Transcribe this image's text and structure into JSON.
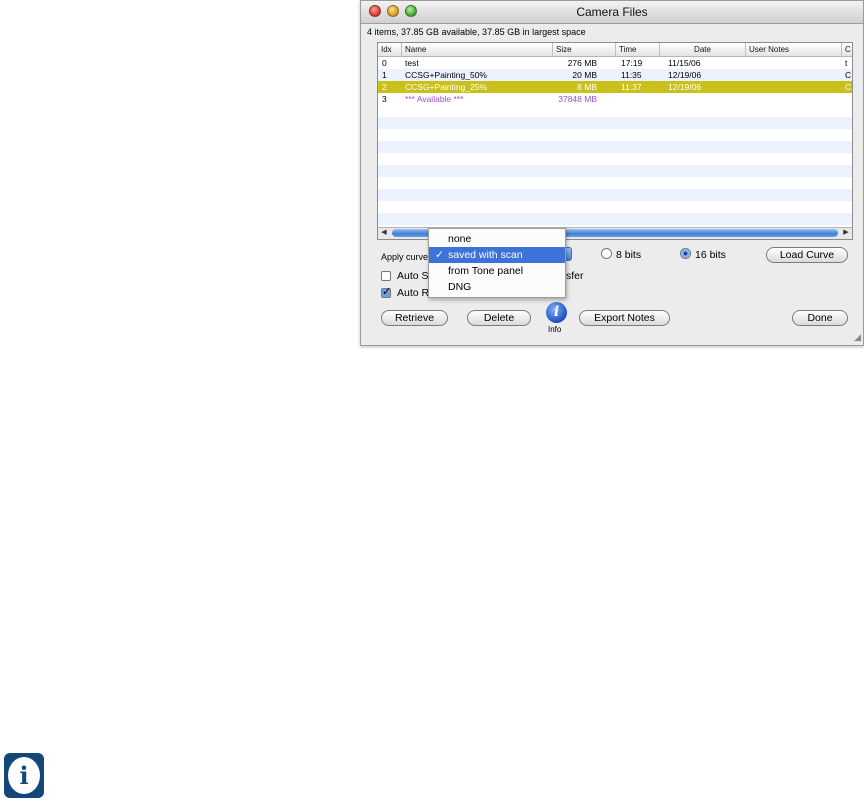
{
  "window": {
    "title": "Camera Files",
    "summary": "4 items,  37.85 GB available,  37.85 GB in largest space"
  },
  "table": {
    "columns": [
      "Idx",
      "Name",
      "Size",
      "Time",
      "Date",
      "User Notes",
      "C"
    ],
    "rows": [
      {
        "idx": "0",
        "name": "test",
        "size": "276 MB",
        "time": "17:19",
        "date": "11/15/06",
        "notes": "",
        "c": "t"
      },
      {
        "idx": "1",
        "name": "CCSG+Painting_50%",
        "size": "20 MB",
        "time": "11:35",
        "date": "12/19/06",
        "notes": "",
        "c": "C"
      },
      {
        "idx": "2",
        "name": "CCSG+Painting_25%",
        "size": "8 MB",
        "time": "11:37",
        "date": "12/19/06",
        "notes": "",
        "c": "C"
      },
      {
        "idx": "3",
        "name": "*** Available ***",
        "size": "37848 MB",
        "time": "",
        "date": "",
        "notes": "",
        "c": ""
      }
    ]
  },
  "controls": {
    "apply_curve_label": "Apply curve",
    "bits8_label": "8 bits",
    "bits16_label": "16 bits",
    "bits_selected": "16 bits",
    "load_curve": "Load Curve",
    "auto_s_label": "Auto S",
    "auto_s_tail": "sfer",
    "auto_s_checked": false,
    "auto_r_label": "Auto R",
    "auto_r_checked": true,
    "retrieve": "Retrieve",
    "delete": "Delete",
    "info": "Info",
    "export_notes": "Export Notes",
    "done": "Done"
  },
  "curve_menu": {
    "options": [
      "none",
      "saved with scan",
      "from Tone panel",
      "DNG"
    ],
    "selected": "saved with scan"
  },
  "icons": {
    "check": "✓",
    "info_glyph": "i",
    "scroll_left": "◀",
    "scroll_right": "▶",
    "grip": "◢"
  },
  "colors": {
    "selected_row": "#c9c11a",
    "available_text": "#9a4fd6",
    "menu_highlight": "#3d72d8",
    "info_badge": "#124777"
  }
}
